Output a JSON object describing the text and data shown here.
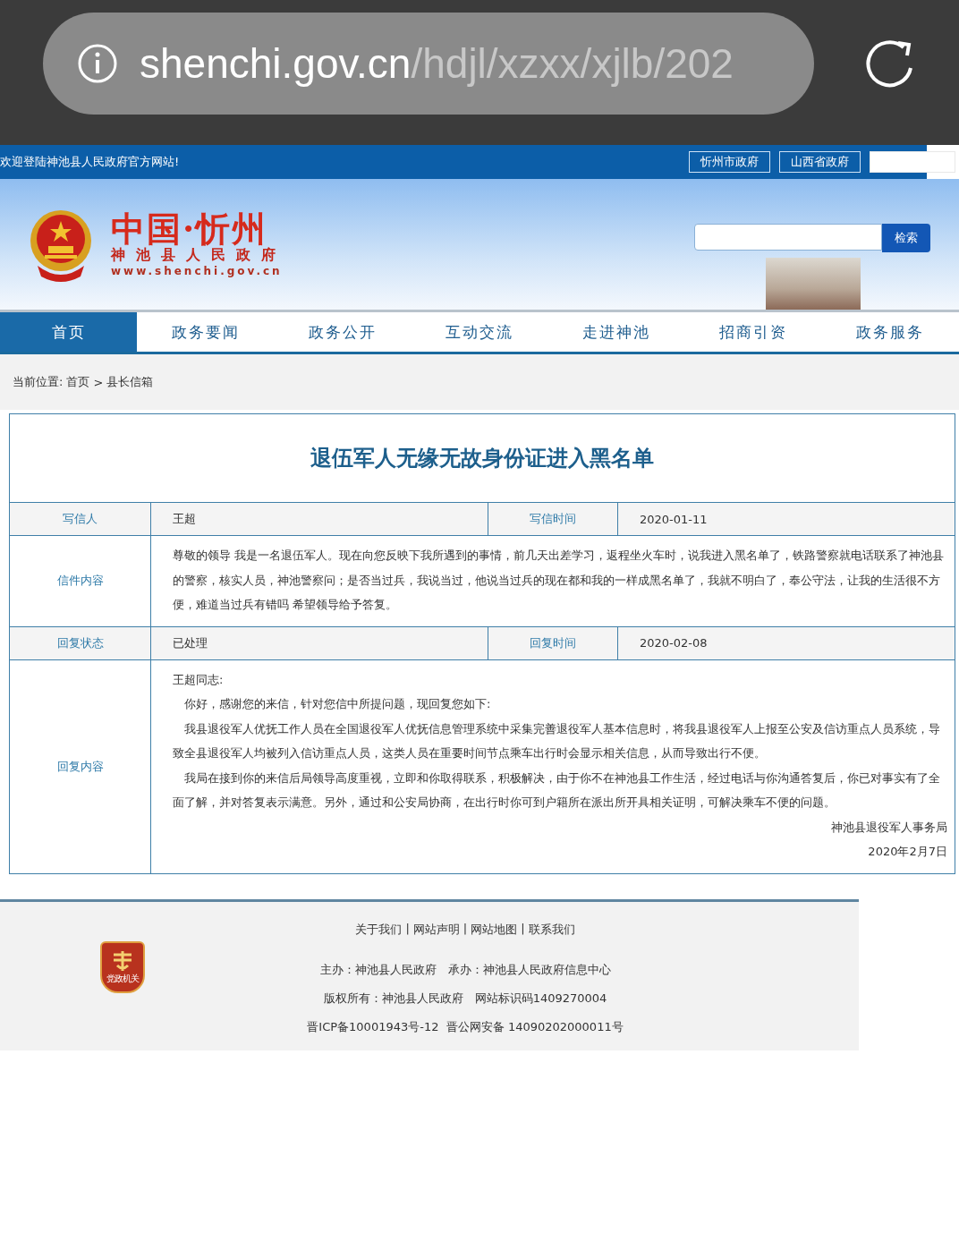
{
  "browser": {
    "url_domain": "shenchi.gov.cn",
    "url_path": "/hdjl/xzxx/xjlb/202"
  },
  "topbar": {
    "welcome": "欢迎登陆神池县人民政府官方网站!",
    "links": [
      "忻州市政府",
      "山西省政府"
    ]
  },
  "header": {
    "logo_title": "中国·忻州",
    "logo_subtitle": "神池县人民政府",
    "logo_url": "www.shenchi.gov.cn",
    "search_button": "检索"
  },
  "nav": [
    {
      "label": "首页",
      "selected": true
    },
    {
      "label": "政务要闻",
      "selected": false
    },
    {
      "label": "政务公开",
      "selected": false
    },
    {
      "label": "互动交流",
      "selected": false
    },
    {
      "label": "走进神池",
      "selected": false
    },
    {
      "label": "招商引资",
      "selected": false
    },
    {
      "label": "政务服务",
      "selected": false
    }
  ],
  "breadcrumb": {
    "label": "当前位置:",
    "items": [
      "首页",
      "县长信箱"
    ],
    "separator": ">"
  },
  "letter": {
    "title": "退伍军人无缘无故身份证进入黑名单",
    "rows": [
      {
        "kind": "pair",
        "label": "写信人",
        "value": "王超",
        "label2": "写信时间",
        "value2": "2020-01-11"
      },
      {
        "kind": "text",
        "label": "信件内容",
        "paragraphs": [
          "尊敬的领导 我是一名退伍军人。现在向您反映下我所遇到的事情，前几天出差学习，返程坐火车时，说我进入黑名单了，铁路警察就电话联系了神池县的警察，核实人员，神池警察问；是否当过兵，我说当过，他说当过兵的现在都和我的一样成黑名单了，我就不明白了，奉公守法，让我的生活很不方便，难道当过兵有错吗 希望领导给予答复。"
        ]
      },
      {
        "kind": "pair",
        "label": "回复状态",
        "value": "已处理",
        "label2": "回复时间",
        "value2": "2020-02-08"
      },
      {
        "kind": "reply",
        "label": "回复内容",
        "salutation": "王超同志:",
        "paragraphs": [
          "你好，感谢您的来信，针对您信中所提问题，现回复您如下:",
          "我县退役军人优抚工作人员在全国退役军人优抚信息管理系统中采集完善退役军人基本信息时，将我县退役军人上报至公安及信访重点人员系统，导致全县退役军人均被列入信访重点人员，这类人员在重要时间节点乘车出行时会显示相关信息，从而导致出行不便。",
          "我局在接到你的来信后局领导高度重视，立即和你取得联系，积极解决，由于你不在神池县工作生活，经过电话与你沟通答复后，你已对事实有了全面了解，并对答复表示满意。另外，通过和公安局协商，在出行时你可到户籍所在派出所开具相关证明，可解决乘车不便的问题。"
        ],
        "signature": "神池县退役军人事务局",
        "date": "2020年2月7日"
      }
    ]
  },
  "footer": {
    "links": [
      "关于我们",
      "网站声明",
      "网站地图",
      "联系我们"
    ],
    "link_separator": "|",
    "badge_text": "党政机关",
    "lines": [
      "主办：神池县人民政府　承办：神池县人民政府信息中心",
      "版权所有：神池县人民政府　网站标识码1409270004",
      "晋ICP备10001943号-12  晋公网安备 14090202000011号"
    ]
  }
}
